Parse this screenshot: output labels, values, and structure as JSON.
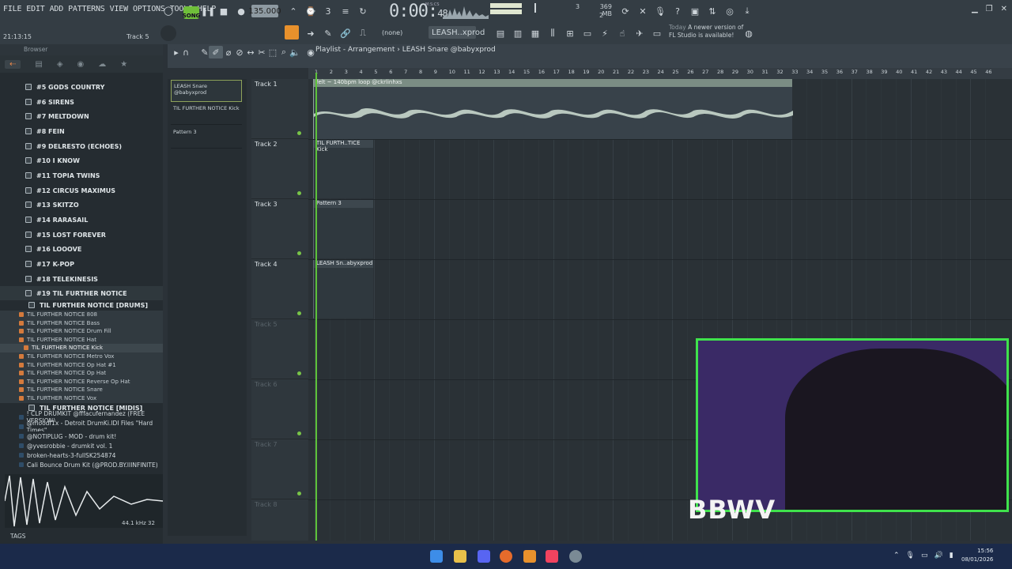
{
  "menu": [
    "FILE",
    "EDIT",
    "ADD",
    "PATTERNS",
    "VIEW",
    "OPTIONS",
    "TOOLS",
    "HELP"
  ],
  "transport": {
    "song_label": "SONG",
    "tempo": "135.000",
    "time": "0:00",
    "time_small": "48",
    "mscs": "M:S:CS",
    "cpu": "3",
    "mem": "369 MB",
    "voices": "2"
  },
  "toolbar": {
    "none_label": "(none)",
    "pattern_label": "LEASH..xprod"
  },
  "update_notice": {
    "when": "Today",
    "line1": "A newer version of",
    "line2": "FL Studio is available!"
  },
  "clock": "21:13:15",
  "track_hint": "Track 5",
  "browser": {
    "title": "Browser",
    "items": [
      {
        "label": "#5 GODS COUNTRY"
      },
      {
        "label": "#6 SIRENS"
      },
      {
        "label": "#7 MELTDOWN"
      },
      {
        "label": "#8 FEIN"
      },
      {
        "label": "#9 DELRESTO (ECHOES)"
      },
      {
        "label": "#10 I KNOW"
      },
      {
        "label": "#11 TOPIA TWINS"
      },
      {
        "label": "#12 CIRCUS MAXIMUS"
      },
      {
        "label": "#13 SKITZO"
      },
      {
        "label": "#14 RARASAIL"
      },
      {
        "label": "#15 LOST FOREVER"
      },
      {
        "label": "#16 LOOOVE"
      },
      {
        "label": "#17 K-POP"
      },
      {
        "label": "#18 TELEKINESIS"
      },
      {
        "label": "#19 TIL FURTHER NOTICE"
      }
    ],
    "subfolder": "TIL FURTHER NOTICE [DRUMS]",
    "files": [
      "TIL FURTHER NOTICE 808",
      "TIL FURTHER NOTICE Bass",
      "TIL FURTHER NOTICE Drum Fill",
      "TIL FURTHER NOTICE Hat",
      "TIL FURTHER NOTICE Kick",
      "TIL FURTHER NOTICE Metro Vox",
      "TIL FURTHER NOTICE Op Hat #1",
      "TIL FURTHER NOTICE Op Hat",
      "TIL FURTHER NOTICE Reverse Op Hat",
      "TIL FURTHER NOTICE Snare",
      "TIL FURTHER NOTICE Vox"
    ],
    "midis": "TIL FURTHER NOTICE [MIDIS]",
    "packs": [
      "! CLP DRUMKIT @fffacufernandez (FREE VERSION)",
      "@moodf1x - Detroit DrumKi.IDI Files \"Hard Times\"",
      "@NOTIPLUG - MOD - drum kit!",
      "@yvesrobbie - drumkit vol. 1",
      "broken-hearts-3-fullSK254874",
      "Cali Bounce Drum Kit (@PROD.BY.IIINFINITE)"
    ],
    "sample_rate": "44.1 kHz 32",
    "tags": "TAGS"
  },
  "playlist": {
    "title": "Playlist - Arrangement",
    "pattern": "LEASH Snare @babyxprod",
    "picker": [
      "LEASH Snare @babyxprod",
      "TIL FURTHER NOTICE Kick",
      "Pattern 3"
    ],
    "tracks": [
      "Track 1",
      "Track 2",
      "Track 3",
      "Track 4",
      "Track 5",
      "Track 6",
      "Track 7",
      "Track 8"
    ],
    "clips": {
      "audio": "felt ~ 140bpm loop @ckrlinhxs",
      "kick": "TIL FURTH..TICE Kick",
      "pattern3": "Pattern 3",
      "leash": "LEASH Sn..abyxprod"
    },
    "ruler": [
      "1",
      "2",
      "3",
      "4",
      "5",
      "6",
      "7",
      "8",
      "9",
      "10",
      "11",
      "12",
      "13",
      "14",
      "15",
      "16",
      "17",
      "18",
      "19",
      "20",
      "21",
      "22",
      "23",
      "24",
      "25",
      "26",
      "27",
      "28",
      "29",
      "30",
      "31",
      "32",
      "33",
      "34",
      "35",
      "36",
      "37",
      "38",
      "39",
      "40",
      "41",
      "42",
      "43",
      "44",
      "45",
      "46"
    ]
  },
  "overlay_logo": "BBWV",
  "system": {
    "time": "15:56",
    "date": "08/01/2026"
  },
  "colors": {
    "accent_green": "#5dc23a",
    "cam_border": "#3fe24c",
    "clip_audio": "#7b8d84"
  }
}
